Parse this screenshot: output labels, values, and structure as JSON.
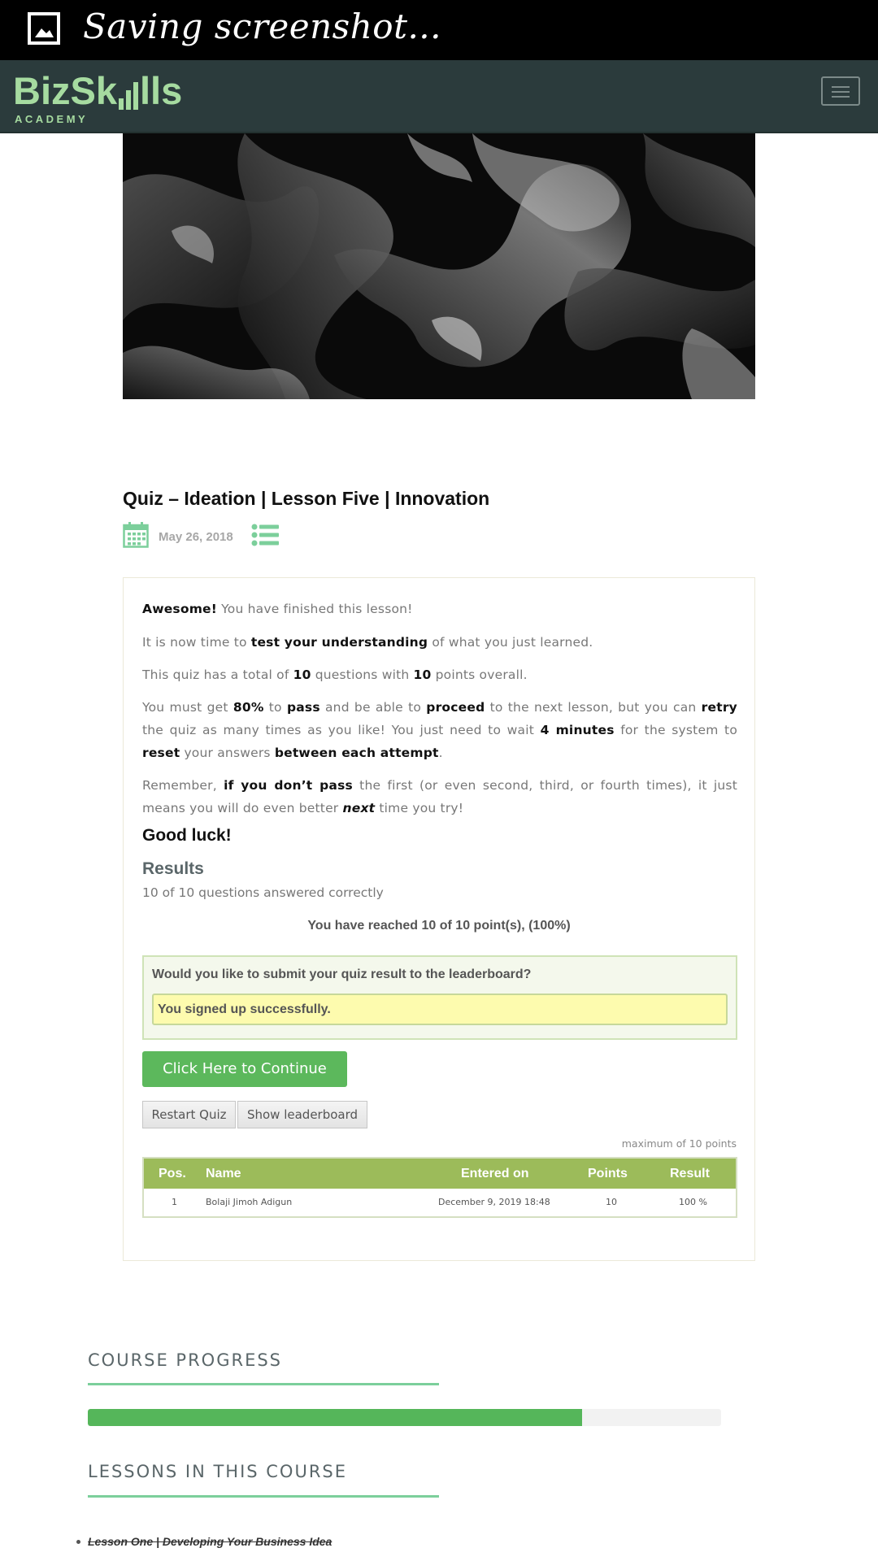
{
  "status_bar": {
    "text": "Saving screenshot...",
    "icon": "image-icon"
  },
  "header": {
    "logo_text_a": "BizSk",
    "logo_text_b": "lls",
    "logo_sub": "ACADEMY",
    "menu_icon": "hamburger-menu-icon",
    "colors": {
      "bar": "#2b3b3c",
      "logo": "#a6dba0"
    }
  },
  "post": {
    "title": "Quiz – Ideation | Lesson Five | Innovation",
    "date": "May 26, 2018",
    "date_icon": "calendar-icon",
    "category_icon": "list-icon"
  },
  "quiz": {
    "p1": {
      "b1": "Awesome!",
      "t1": " You have finished this lesson!"
    },
    "p2": {
      "t1": "It is now time to ",
      "b1": "test your understanding",
      "t2": " of what you just learned."
    },
    "p3": {
      "t1": "This quiz has a total of ",
      "b1": "10",
      "t2": " questions with ",
      "b2": "10",
      "t3": " points overall."
    },
    "p4": {
      "t1": "You must get ",
      "b1": "80%",
      "t2": " to ",
      "b2": "pass",
      "t3": " and be able to ",
      "b3": "proceed",
      "t4": " to the next lesson, but you can ",
      "b4": "retry",
      "t5": " the quiz as many times as you like! You just need to wait ",
      "b5": "4 minutes",
      "t6": " for the system to ",
      "b6": "reset",
      "t7": " your answers ",
      "b7": "between each attempt",
      "t8": "."
    },
    "p5": {
      "t1": "Remember, ",
      "b1": "if you don’t pass",
      "t2": " the first (or even second, third, or fourth times), it just means you will do even better ",
      "b2": "next",
      "t3": " time you try!"
    },
    "good_luck": "Good luck!",
    "results_heading": "Results",
    "results_summary": "10 of 10 questions answered correctly",
    "points_reached": "You have reached 10 of 10 point(s), (100%)",
    "leaderboard_prompt": "Would you like to submit your quiz result to the leaderboard?",
    "signup_message": "You signed up successfully.",
    "continue_label": "Click Here to Continue",
    "restart_label": "Restart Quiz",
    "show_leaderboard_label": "Show leaderboard",
    "max_points": "maximum of 10 points",
    "table": {
      "headers": [
        "Pos.",
        "Name",
        "Entered on",
        "Points",
        "Result"
      ],
      "rows": [
        [
          "1",
          "Bolaji Jimoh Adigun",
          "December 9, 2019 18:48",
          "10",
          "100 %"
        ]
      ]
    },
    "colors": {
      "continue": "#5cb85c",
      "table_header": "#9cbb5a",
      "signup_bg": "#fdfbae"
    }
  },
  "course_progress": {
    "title": "COURSE PROGRESS",
    "progress_fraction": 0.78,
    "bar_color": "#55b65a"
  },
  "lessons": {
    "title": "LESSONS IN THIS COURSE",
    "items": [
      "Lesson One | Developing Your Business Idea"
    ]
  }
}
